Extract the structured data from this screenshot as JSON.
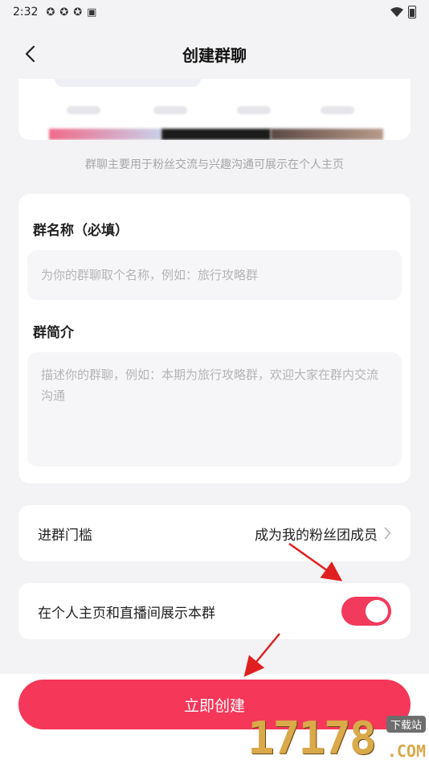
{
  "status_bar": {
    "time": "2:32",
    "icons": [
      "notification-icon",
      "notification-icon",
      "notification-icon",
      "app-icon"
    ]
  },
  "nav": {
    "title": "创建群聊",
    "back_icon": "chevron-left-icon"
  },
  "hint": "群聊主要用于粉丝交流与兴趣沟通可展示在个人主页",
  "form": {
    "name_label": "群名称（必填）",
    "name_placeholder": "为你的群聊取个名称，例如：旅行攻略群",
    "intro_label": "群简介",
    "intro_placeholder": "描述你的群聊，例如：本期为旅行攻略群，欢迎大家在群内交流沟通"
  },
  "threshold": {
    "label": "进群门槛",
    "value": "成为我的粉丝团成员"
  },
  "display_toggle": {
    "label": "在个人主页和直播间展示本群",
    "on": true
  },
  "create_button": "立即创建",
  "watermark": {
    "digits": "17178",
    "tag": "下载站",
    "com": ".COM"
  },
  "colors": {
    "accent": "#f5375a",
    "annotation_arrow": "#e02020"
  }
}
